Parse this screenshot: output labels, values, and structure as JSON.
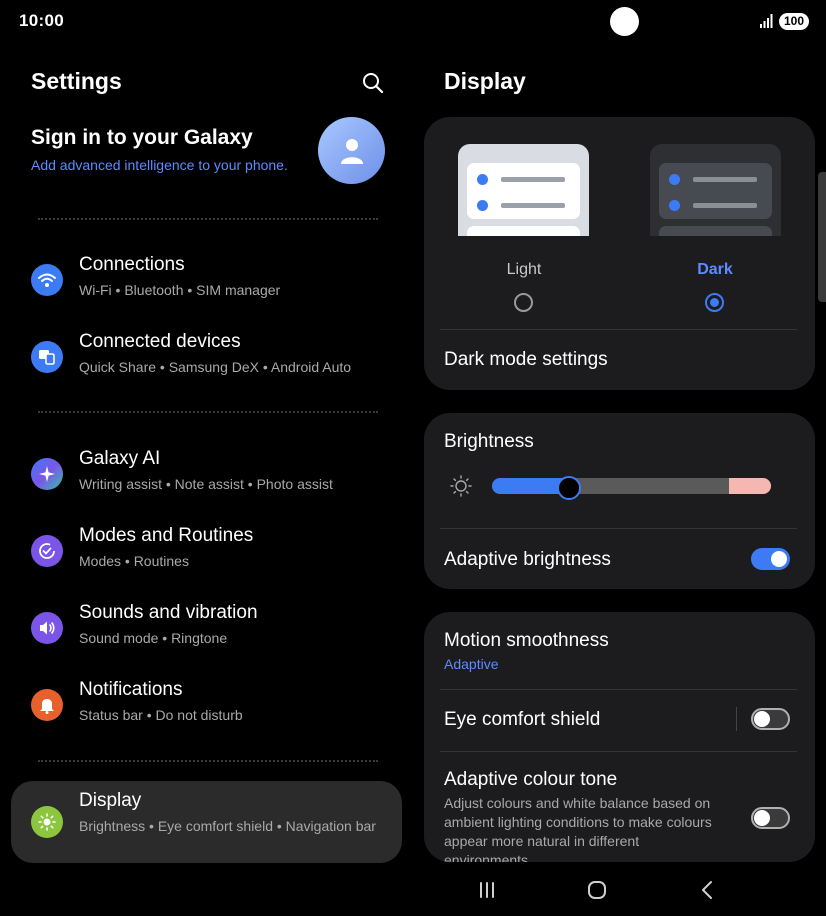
{
  "status_bar": {
    "time": "10:00",
    "battery": "100",
    "icons": [
      "signal-icon",
      "battery-icon"
    ]
  },
  "left": {
    "title": "Settings",
    "search_icon": "search-icon",
    "account": {
      "title": "Sign in to your Galaxy",
      "subtitle": "Add advanced intelligence to your phone.",
      "avatar_icon": "person-icon"
    },
    "items": [
      {
        "label": "Connections",
        "sub": "Wi-Fi  •  Bluetooth  •  SIM manager",
        "icon": "wifi-icon",
        "color": "#3d7bf5"
      },
      {
        "label": "Connected devices",
        "sub": "Quick Share  •  Samsung DeX  •  Android Auto",
        "icon": "devices-icon",
        "color": "#3d7bf5"
      },
      {
        "label": "Galaxy AI",
        "sub": "Writing assist  •  Note assist  •  Photo assist",
        "icon": "sparkle-icon",
        "color": "#5a6cf0"
      },
      {
        "label": "Modes and Routines",
        "sub": "Modes  •  Routines",
        "icon": "routine-icon",
        "color": "#7b55e8"
      },
      {
        "label": "Sounds and vibration",
        "sub": "Sound mode  •  Ringtone",
        "icon": "speaker-icon",
        "color": "#7b55e8"
      },
      {
        "label": "Notifications",
        "sub": "Status bar  •  Do not disturb",
        "icon": "bell-icon",
        "color": "#e8602c"
      },
      {
        "label": "Display",
        "sub": "Brightness  •  Eye comfort shield  •  Navigation bar",
        "icon": "sun-icon",
        "color": "#8cc63f"
      }
    ]
  },
  "right": {
    "title": "Display",
    "theme": {
      "light_label": "Light",
      "dark_label": "Dark",
      "selected": "dark",
      "dark_mode_settings": "Dark mode settings"
    },
    "brightness": {
      "label": "Brightness",
      "level_percent": 27,
      "adaptive_label": "Adaptive brightness",
      "adaptive_on": true
    },
    "motion": {
      "label": "Motion smoothness",
      "value": "Adaptive"
    },
    "eye_comfort": {
      "label": "Eye comfort shield",
      "on": false
    },
    "adaptive_tone": {
      "label": "Adaptive colour tone",
      "desc": "Adjust colours and white balance based on ambient lighting conditions to make colours appear more natural in different environments.",
      "on": false
    }
  },
  "nav_bar": {
    "recents_icon": "recents-icon",
    "home_icon": "home-icon",
    "back_icon": "back-icon"
  },
  "colors": {
    "accent": "#3d7bf5",
    "link": "#5b8bff",
    "card": "#1c1c1e"
  }
}
